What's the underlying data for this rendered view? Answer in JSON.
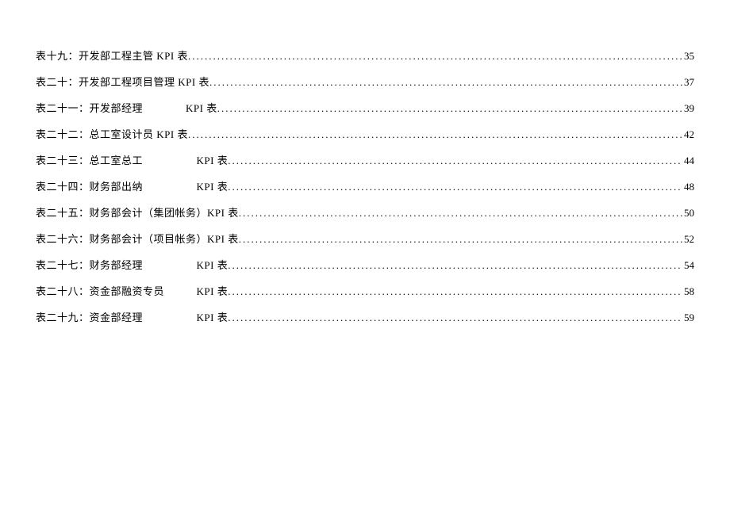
{
  "toc": {
    "items": [
      {
        "label": "表十九：开发部工程主管 KPI 表 ",
        "page": "35"
      },
      {
        "label": "表二十：开发部工程项目管理 KPI 表",
        "page": "37"
      },
      {
        "label": "表二十一：开发部经理　　　　KPI 表",
        "page": "39"
      },
      {
        "label": "表二十二：总工室设计员 KPI 表 ",
        "page": "42"
      },
      {
        "label": "表二十三：总工室总工　　　　　KPI 表",
        "page": "44"
      },
      {
        "label": "表二十四：财务部出纳　　　　　KPI 表",
        "page": "48"
      },
      {
        "label": "表二十五：财务部会计（集团帐务）KPI 表",
        "page": "50"
      },
      {
        "label": "表二十六：财务部会计（项目帐务）KPI 表",
        "page": "52"
      },
      {
        "label": "表二十七：财务部经理　　　　　KPI 表",
        "page": "54"
      },
      {
        "label": "表二十八：资金部融资专员　　　KPI 表",
        "page": "58"
      },
      {
        "label": "表二十九：资金部经理　　　　　KPI 表",
        "page": "59"
      }
    ]
  }
}
